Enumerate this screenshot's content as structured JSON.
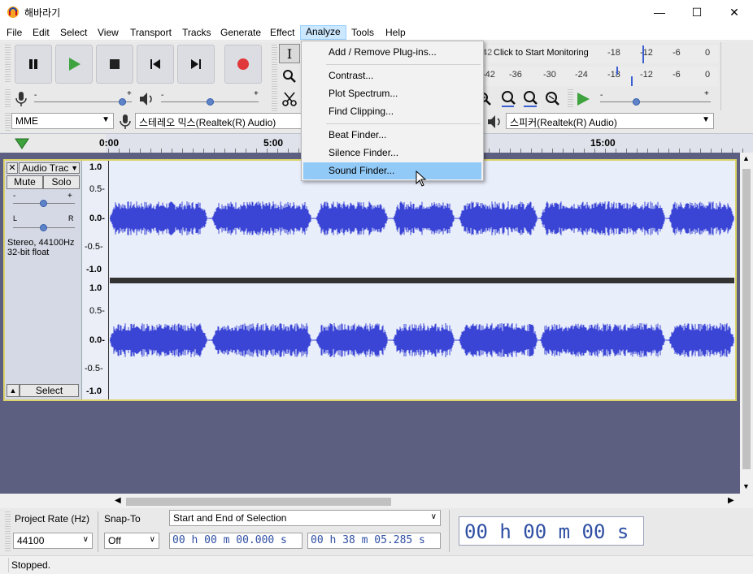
{
  "window": {
    "title": "해바라기",
    "min_glyph": "—",
    "max_glyph": "☐",
    "close_glyph": "✕"
  },
  "menubar": [
    "File",
    "Edit",
    "Select",
    "View",
    "Transport",
    "Tracks",
    "Generate",
    "Effect",
    "Analyze",
    "Tools",
    "Help"
  ],
  "analyze_menu": {
    "items": [
      "Add / Remove Plug-ins...",
      "Contrast...",
      "Plot Spectrum...",
      "Find Clipping...",
      "Beat Finder...",
      "Silence Finder...",
      "Sound Finder..."
    ],
    "highlighted": "Sound Finder..."
  },
  "meters": {
    "record_label": "Click to Start Monitoring",
    "record_scale": [
      "-18",
      "-12",
      "-6",
      "0"
    ],
    "play_scale_1": [
      "-42",
      "-36",
      "-30",
      "-24",
      "-18",
      "-12",
      "-6",
      "0"
    ],
    "clip_left": "42",
    "clip_right": "42"
  },
  "devices": {
    "host": "MME",
    "input": "스테레오 믹스(Realtek(R) Audio)",
    "output": "스피커(Realtek(R) Audio)"
  },
  "ruler": {
    "ticks": [
      "0:00",
      "5:00",
      "15:00"
    ]
  },
  "track": {
    "name": "Audio Trac",
    "mute": "Mute",
    "solo": "Solo",
    "gain_minus": "-",
    "gain_plus": "+",
    "pan_l": "L",
    "pan_r": "R",
    "info_line1": "Stereo, 44100Hz",
    "info_line2": "32-bit float",
    "select": "Select",
    "scale": [
      "1.0",
      "0.5-",
      "0.0-",
      "-0.5-",
      "-1.0"
    ]
  },
  "bottom": {
    "project_rate_label": "Project Rate (Hz)",
    "snap_label": "Snap-To",
    "project_rate": "44100",
    "snap": "Off",
    "selection_mode": "Start and End of Selection",
    "sel_start": "00 h 00 m 00.000 s",
    "sel_end": "00 h 38 m 05.285 s",
    "big_time": "00 h 00 m 00 s"
  },
  "status": "Stopped.",
  "colors": {
    "waveform": "#3a45d6",
    "wave_bg": "#e9eefb",
    "accent": "#91c9f7",
    "record": "#e0373a",
    "play": "#3ea33e"
  }
}
